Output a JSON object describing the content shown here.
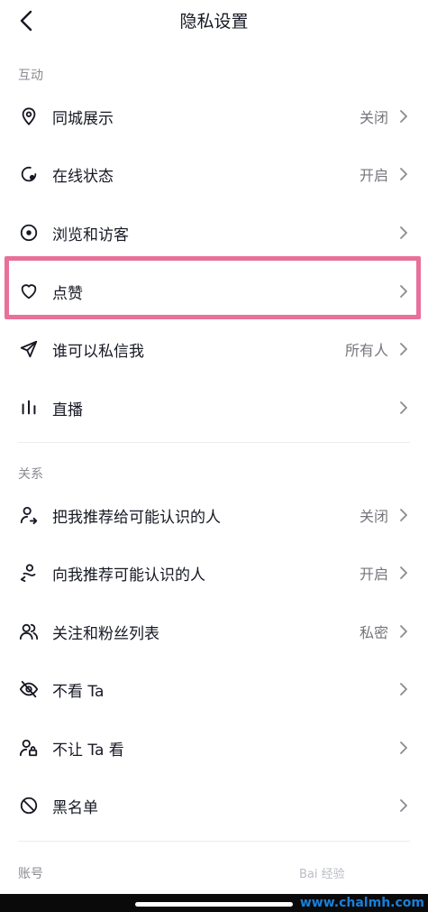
{
  "header": {
    "title": "隐私设置"
  },
  "sections": [
    {
      "title": "互动",
      "items": [
        {
          "icon": "location-pin-icon",
          "label": "同城展示",
          "value": "关闭"
        },
        {
          "icon": "online-status-icon",
          "label": "在线状态",
          "value": "开启"
        },
        {
          "icon": "eye-icon",
          "label": "浏览和访客",
          "value": ""
        },
        {
          "icon": "heart-icon",
          "label": "点赞",
          "value": ""
        },
        {
          "icon": "send-icon",
          "label": "谁可以私信我",
          "value": "所有人"
        },
        {
          "icon": "live-bars-icon",
          "label": "直播",
          "value": ""
        }
      ]
    },
    {
      "title": "关系",
      "items": [
        {
          "icon": "user-share-icon",
          "label": "把我推荐给可能认识的人",
          "value": "关闭"
        },
        {
          "icon": "user-recommend-icon",
          "label": "向我推荐可能认识的人",
          "value": "开启"
        },
        {
          "icon": "users-icon",
          "label": "关注和粉丝列表",
          "value": "私密"
        },
        {
          "icon": "eye-off-icon",
          "label": "不看 Ta",
          "value": ""
        },
        {
          "icon": "user-lock-icon",
          "label": "不让 Ta 看",
          "value": ""
        },
        {
          "icon": "block-icon",
          "label": "黑名单",
          "value": ""
        }
      ]
    },
    {
      "title": "账号",
      "items": []
    }
  ],
  "highlight_color": "#e8709a",
  "watermark": "www.chalmh.com",
  "baidu_watermark": "Bai 经验"
}
